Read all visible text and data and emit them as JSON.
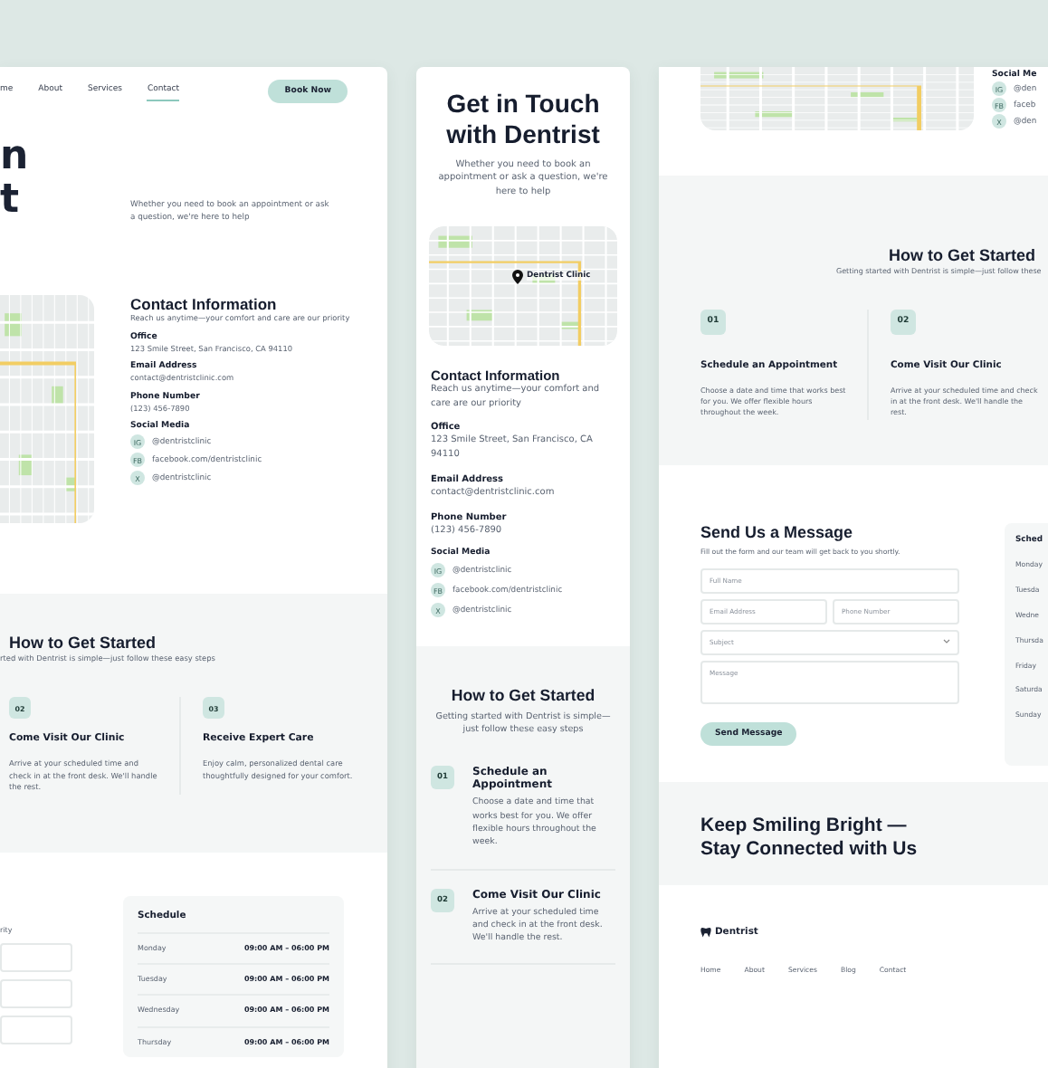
{
  "desktop_left": {
    "nav": [
      {
        "label": "me",
        "selected": false
      },
      {
        "label": "About",
        "selected": false
      },
      {
        "label": "Services",
        "selected": false
      },
      {
        "label": "Contact",
        "selected": true
      }
    ],
    "book_button": "Book Now",
    "hero": {
      "title_lines": [
        "n",
        "t"
      ],
      "subtitle": "Whether you need to book an appointment or ask a question, we're here to help"
    },
    "contact": {
      "title": "Contact Information",
      "subtitle": "Reach us anytime—your comfort and care are our priority",
      "fields": [
        {
          "label": "Office",
          "value": "123 Smile Street, San Francisco, CA 94110"
        },
        {
          "label": "Email Address",
          "value": "contact@dentristclinic.com"
        },
        {
          "label": "Phone Number",
          "value": "(123) 456-7890"
        }
      ],
      "social_label": "Social Media",
      "socials": [
        {
          "badge": "IG",
          "handle": "@dentristclinic"
        },
        {
          "badge": "FB",
          "handle": "facebook.com/dentristclinic"
        },
        {
          "badge": "X",
          "handle": "@dentristclinic"
        }
      ]
    },
    "steps_section": {
      "title": "How to Get Started",
      "subtitle": "rted with Dentrist is simple—just follow these easy steps",
      "steps": [
        {
          "number": "02",
          "title": "Come Visit Our Clinic",
          "text": "Arrive at your scheduled time and check in at the front desk. We'll handle the rest."
        },
        {
          "number": "03",
          "title": "Receive Expert Care",
          "text": "Enjoy calm, personalized dental care thoughtfully designed for your comfort."
        }
      ]
    },
    "form_fragment": "rity",
    "schedule": {
      "title": "Schedule",
      "rows": [
        {
          "day": "Monday",
          "hours": "09:00 AM – 06:00 PM"
        },
        {
          "day": "Tuesday",
          "hours": "09:00 AM – 06:00 PM"
        },
        {
          "day": "Wednesday",
          "hours": "09:00 AM – 06:00 PM"
        },
        {
          "day": "Thursday",
          "hours": "09:00 AM – 06:00 PM"
        }
      ]
    }
  },
  "mobile": {
    "title": "Get in Touch with Dentrist",
    "subtitle": "Whether you need to book an appointment or ask a question, we're here to help",
    "map_label": "Dentrist Clinic",
    "contact": {
      "title": "Contact Information",
      "subtitle": "Reach us anytime—your comfort and care are our priority",
      "fields": [
        {
          "label": "Office",
          "value": "123 Smile Street, San Francisco, CA 94110"
        },
        {
          "label": "Email Address",
          "value": "contact@dentristclinic.com"
        },
        {
          "label": "Phone Number",
          "value": "(123) 456-7890"
        }
      ],
      "social_label": "Social Media",
      "socials": [
        {
          "badge": "IG",
          "handle": "@dentristclinic"
        },
        {
          "badge": "FB",
          "handle": "facebook.com/dentristclinic"
        },
        {
          "badge": "X",
          "handle": "@dentristclinic"
        }
      ]
    },
    "steps_section": {
      "title": "How to Get Started",
      "subtitle": "Getting started with Dentrist is simple—just follow these easy steps",
      "steps": [
        {
          "number": "01",
          "title": "Schedule an Appointment",
          "text": "Choose a date and time that works best for you. We offer flexible hours throughout the week."
        },
        {
          "number": "02",
          "title": "Come Visit Our Clinic",
          "text": "Arrive at your scheduled time and check in at the front desk. We'll handle the rest."
        }
      ]
    }
  },
  "desktop_right": {
    "social_label": "Social Me",
    "socials": [
      {
        "badge": "IG",
        "handle": "@den"
      },
      {
        "badge": "FB",
        "handle": "faceb"
      },
      {
        "badge": "X",
        "handle": "@den"
      }
    ],
    "steps_section": {
      "title": "How to Get Started",
      "subtitle": "Getting started with Dentrist is simple—just follow these",
      "steps": [
        {
          "number": "01",
          "title": "Schedule an Appointment",
          "text": "Choose a date and time that works best for you. We offer flexible hours throughout the week."
        },
        {
          "number": "02",
          "title": "Come Visit Our Clinic",
          "text": "Arrive at your scheduled time and check in at the front desk. We'll handle the rest."
        }
      ]
    },
    "form": {
      "title": "Send Us a Message",
      "subtitle": "Fill out the form and our team will get back to you shortly.",
      "fields": [
        {
          "placeholder": "Full Name",
          "kind": "text"
        },
        {
          "placeholder": "Email Address",
          "kind": "half"
        },
        {
          "placeholder": "Phone Number",
          "kind": "half"
        },
        {
          "placeholder": "Subject",
          "kind": "select"
        },
        {
          "placeholder": "Message",
          "kind": "textarea"
        }
      ],
      "button": "Send Message"
    },
    "schedule": {
      "title": "Sched",
      "days": [
        "Monday",
        "Tuesda",
        "Wedne",
        "Thursda",
        "Friday",
        "Saturda",
        "Sunday"
      ]
    },
    "cta_lines": [
      "Keep Smiling Bright —",
      "Stay Connected with Us"
    ],
    "footer": {
      "brand": "Dentrist",
      "links": [
        "Home",
        "About",
        "Services",
        "Blog",
        "Contact"
      ]
    }
  }
}
